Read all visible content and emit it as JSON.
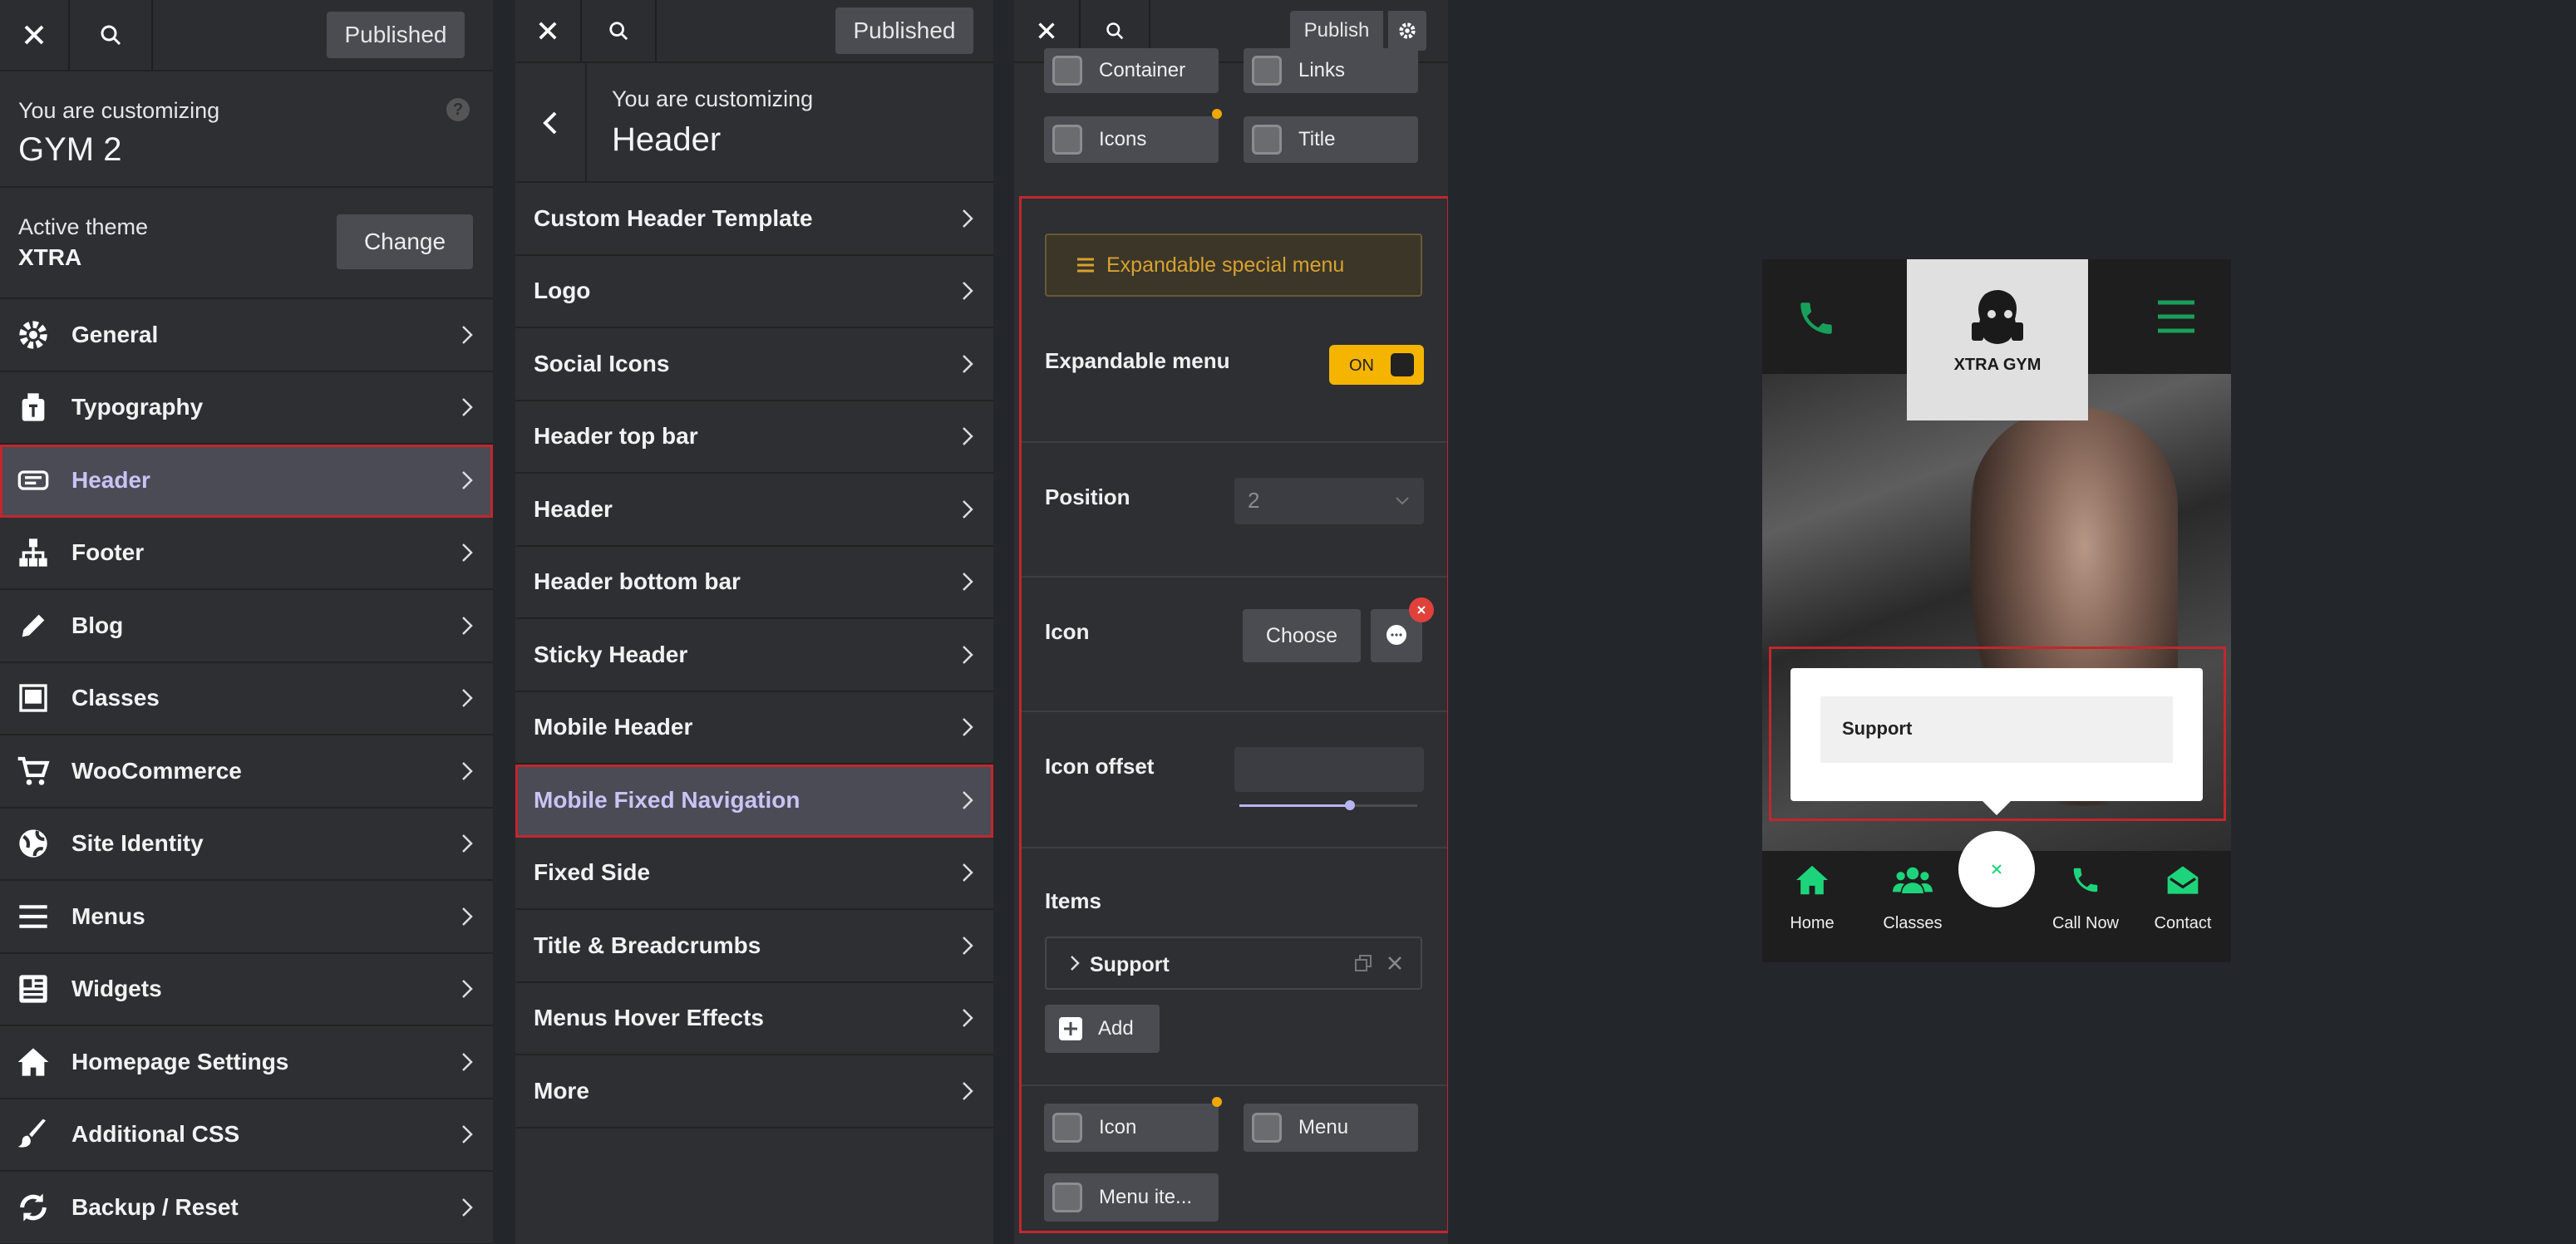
{
  "panel1": {
    "close": "✕",
    "published": "Published",
    "customizing": "You are customizing",
    "site": "GYM 2",
    "active_theme_label": "Active theme",
    "theme": "XTRA",
    "change": "Change",
    "items": [
      {
        "label": "General",
        "icon": "gear-icon"
      },
      {
        "label": "Typography",
        "icon": "typography-icon"
      },
      {
        "label": "Header",
        "icon": "header-icon",
        "active": true
      },
      {
        "label": "Footer",
        "icon": "footer-icon"
      },
      {
        "label": "Blog",
        "icon": "pencil-icon"
      },
      {
        "label": "Classes",
        "icon": "classes-icon"
      },
      {
        "label": "WooCommerce",
        "icon": "cart-icon"
      },
      {
        "label": "Site Identity",
        "icon": "globe-icon"
      },
      {
        "label": "Menus",
        "icon": "menu-icon"
      },
      {
        "label": "Widgets",
        "icon": "widgets-icon"
      },
      {
        "label": "Homepage Settings",
        "icon": "home-icon"
      },
      {
        "label": "Additional CSS",
        "icon": "brush-icon"
      },
      {
        "label": "Backup / Reset",
        "icon": "refresh-icon"
      }
    ]
  },
  "panel2": {
    "published": "Published",
    "customizing": "You are customizing",
    "section": "Header",
    "items": [
      {
        "label": "Custom Header Template"
      },
      {
        "label": "Logo"
      },
      {
        "label": "Social Icons"
      },
      {
        "label": "Header top bar"
      },
      {
        "label": "Header"
      },
      {
        "label": "Header bottom bar"
      },
      {
        "label": "Sticky Header"
      },
      {
        "label": "Mobile Header"
      },
      {
        "label": "Mobile Fixed Navigation",
        "active": true
      },
      {
        "label": "Fixed Side"
      },
      {
        "label": "Title & Breadcrumbs"
      },
      {
        "label": "Menus Hover Effects"
      },
      {
        "label": "More"
      }
    ]
  },
  "panel3": {
    "publish": "Publish",
    "top_checks": [
      "Container",
      "Links",
      "Icons",
      "Title"
    ],
    "special_menu": "Expandable special menu",
    "expandable_label": "Expandable menu",
    "toggle": "ON",
    "position_label": "Position",
    "position_value": "2",
    "icon_label": "Icon",
    "choose": "Choose",
    "icon_offset_label": "Icon offset",
    "icon_offset_level_percent": 62,
    "items_label": "Items",
    "item_name": "Support",
    "add": "Add",
    "bottom_checks": [
      "Icon",
      "Menu",
      "Menu ite..."
    ]
  },
  "preview": {
    "logo": "XTRA GYM",
    "support": "Support",
    "nav": [
      {
        "label": "Home",
        "icon": "home-icon"
      },
      {
        "label": "Classes",
        "icon": "users-icon"
      },
      {
        "label": "Call Now",
        "icon": "phone-icon"
      },
      {
        "label": "Contact",
        "icon": "envelope-open-icon"
      }
    ],
    "accent": "#1ed47a"
  }
}
